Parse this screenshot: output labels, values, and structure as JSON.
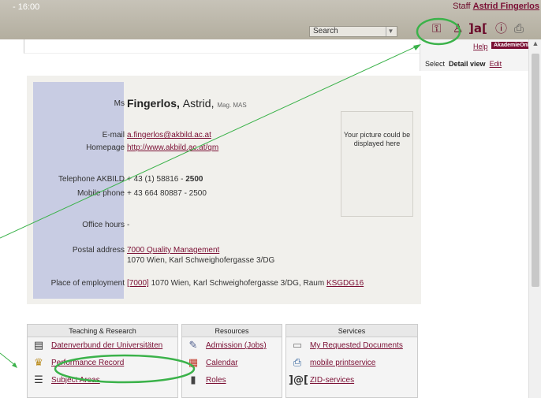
{
  "topbar": {
    "time": "- 16:00",
    "staff_prefix": "Staff",
    "staff_name": "Astrid Fingerlos",
    "search_label": "Search"
  },
  "right_panel": {
    "help": "Help",
    "brand": "AkademieOnline",
    "select": "Select",
    "detail_view": "Detail view",
    "edit": "Edit"
  },
  "profile": {
    "salutation": "Ms",
    "surname": "Fingerlos,",
    "given_name": "Astrid,",
    "degree": "Mag. MAS",
    "email_label": "E-mail",
    "email": "a.fingerlos@akbild.ac.at",
    "homepage_label": "Homepage",
    "homepage": "http://www.akbild.ac.at/qm",
    "telephone_label": "Telephone  AKBILD",
    "telephone_prefix": "+ 43 (1) 58816 - ",
    "telephone_ext": "2500",
    "mobile_label": "Mobile phone",
    "mobile": "+ 43 664 80887 - 2500",
    "office_label": "Office hours",
    "office": "-",
    "postal_label": "Postal address",
    "postal_link": "7000 Quality Management",
    "postal_line2": "1070 Wien, Karl Schweighofergasse 3/DG",
    "employment_label": "Place of employment",
    "employment_code": "[7000]",
    "employment_text": "1070 Wien, Karl Schweighofergasse 3/DG, Raum",
    "employment_room": "KSGDG16",
    "picture_text": "Your picture could be displayed here"
  },
  "sections": {
    "teaching": {
      "title": "Teaching & Research",
      "items": [
        "Datenverbund der Universitäten",
        "Performance Record",
        "Subject Areas"
      ]
    },
    "resources": {
      "title": "Resources",
      "items": [
        "Admission (Jobs)",
        "Calendar",
        "Roles"
      ]
    },
    "services": {
      "title": "Services",
      "items": [
        "My Requested Documents",
        "mobile printservice",
        "ZID-services"
      ]
    }
  },
  "icons": [
    "key-icon",
    "person-icon",
    "bracket-icon",
    "info-icon",
    "print-icon"
  ],
  "colors": {
    "accent": "#7a0e33",
    "annotation": "#3bb24a"
  }
}
